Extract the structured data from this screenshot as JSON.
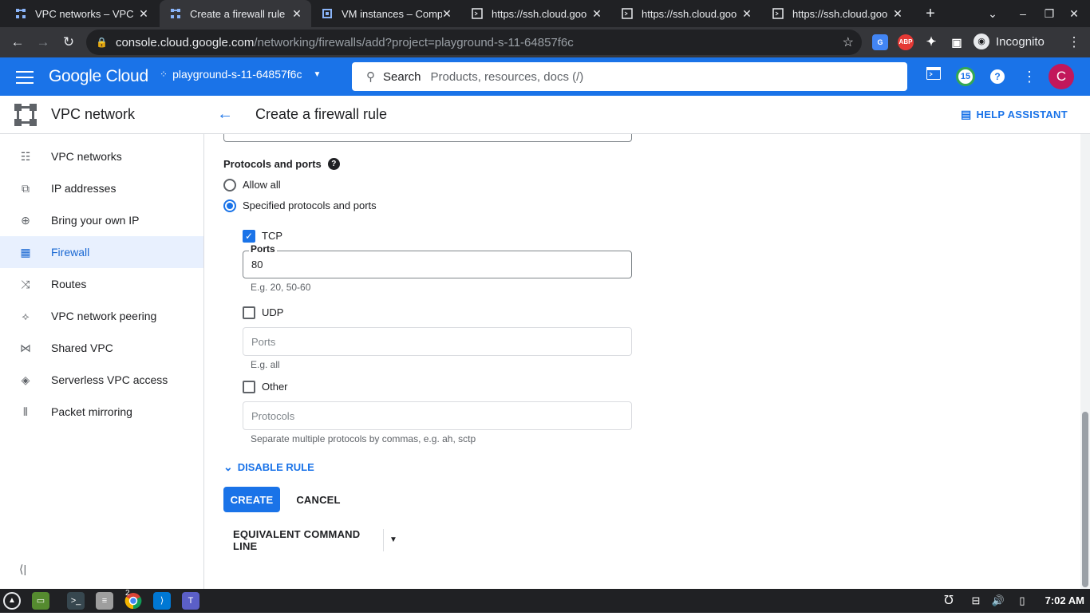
{
  "browser": {
    "tabs": [
      {
        "title": "VPC networks – VPC n",
        "active": false
      },
      {
        "title": "Create a firewall rule",
        "active": true
      },
      {
        "title": "VM instances – Comp",
        "active": false
      },
      {
        "title": "https://ssh.cloud.goo",
        "active": false
      },
      {
        "title": "https://ssh.cloud.goo",
        "active": false
      },
      {
        "title": "https://ssh.cloud.goo",
        "active": false
      }
    ],
    "url_host": "console.cloud.google.com",
    "url_path": "/networking/firewalls/add?project=playground-s-11-64857f6c",
    "incognito_label": "Incognito",
    "abp_label": "ABP"
  },
  "cloud_header": {
    "logo": "Google Cloud",
    "project": "playground-s-11-64857f6c",
    "search_label": "Search",
    "search_placeholder": "Products, resources, docs (/)",
    "notification_count": "15",
    "avatar_letter": "C"
  },
  "app_header": {
    "product": "VPC network",
    "page_title": "Create a firewall rule",
    "help_assistant": "HELP ASSISTANT"
  },
  "sidebar": {
    "items": [
      {
        "label": "VPC networks",
        "icon": "vpc-networks-icon",
        "selected": false
      },
      {
        "label": "IP addresses",
        "icon": "ip-addresses-icon",
        "selected": false
      },
      {
        "label": "Bring your own IP",
        "icon": "globe-icon",
        "selected": false
      },
      {
        "label": "Firewall",
        "icon": "firewall-icon",
        "selected": true
      },
      {
        "label": "Routes",
        "icon": "routes-icon",
        "selected": false
      },
      {
        "label": "VPC network peering",
        "icon": "peering-icon",
        "selected": false
      },
      {
        "label": "Shared VPC",
        "icon": "shared-vpc-icon",
        "selected": false
      },
      {
        "label": "Serverless VPC access",
        "icon": "serverless-icon",
        "selected": false
      },
      {
        "label": "Packet mirroring",
        "icon": "packet-mirroring-icon",
        "selected": false
      }
    ]
  },
  "form": {
    "protocols_heading": "Protocols and ports",
    "allow_all": "Allow all",
    "specified": "Specified protocols and ports",
    "tcp": {
      "label": "TCP",
      "checked": true,
      "ports_label": "Ports",
      "ports_value": "80",
      "hint": "E.g. 20, 50-60"
    },
    "udp": {
      "label": "UDP",
      "checked": false,
      "placeholder": "Ports",
      "hint": "E.g. all"
    },
    "other": {
      "label": "Other",
      "checked": false,
      "placeholder": "Protocols",
      "hint": "Separate multiple protocols by commas, e.g. ah, sctp"
    },
    "disable_rule": "DISABLE RULE",
    "create": "CREATE",
    "cancel": "CANCEL",
    "equivalent": "EQUIVALENT COMMAND LINE"
  },
  "taskbar": {
    "chrome_badge": "2",
    "clock": "7:02 AM"
  },
  "colors": {
    "accent": "#1a73e8",
    "avatar": "#c2185b",
    "notif": "#0f9d58"
  }
}
